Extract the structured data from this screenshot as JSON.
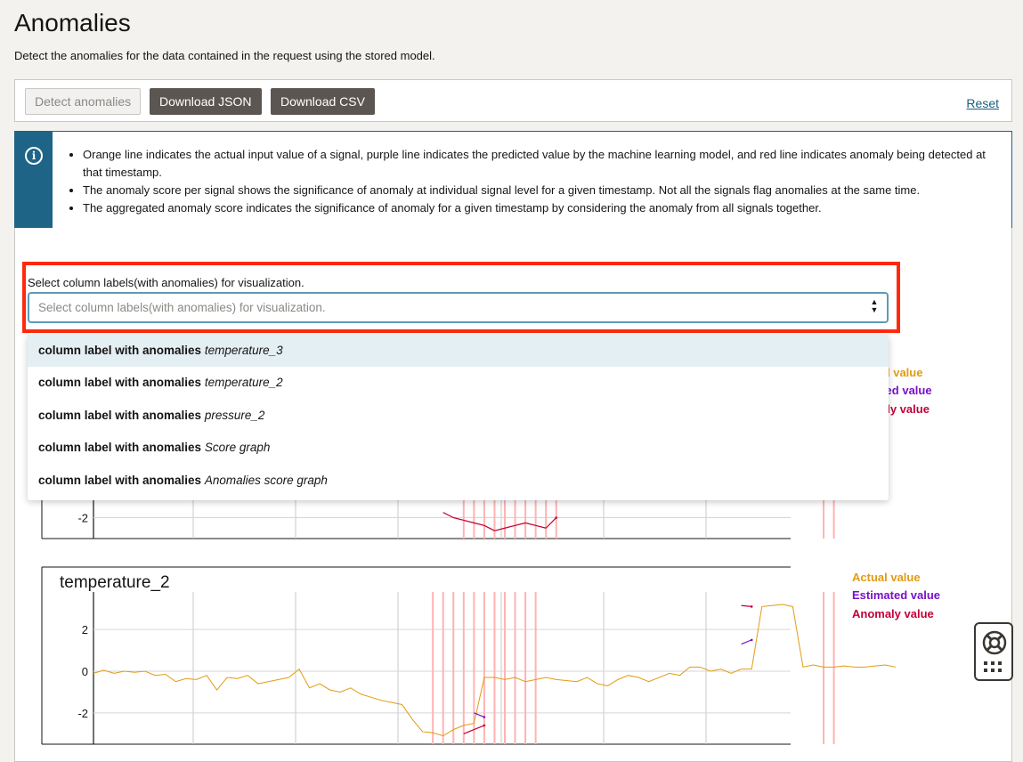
{
  "page": {
    "title": "Anomalies",
    "subtitle": "Detect the anomalies for the data contained in the request using the stored model."
  },
  "toolbar": {
    "detect_label": "Detect anomalies",
    "download_json_label": "Download JSON",
    "download_csv_label": "Download CSV",
    "reset_label": "Reset"
  },
  "info": {
    "icon": "info-icon",
    "items": [
      "Orange line indicates the actual input value of a signal, purple line indicates the predicted value by the machine learning model, and red line indicates anomaly being detected at that timestamp.",
      "The anomaly score per signal shows the significance of anomaly at individual signal level for a given timestamp. Not all the signals flag anomalies at the same time.",
      "The aggregated anomaly score indicates the significance of anomaly for a given timestamp by considering the anomaly from all signals together."
    ]
  },
  "select": {
    "label": "Select column labels(with anomalies) for visualization.",
    "placeholder": "Select column labels(with anomalies) for visualization.",
    "options": [
      {
        "prefix": "column label with anomalies",
        "name": "temperature_3"
      },
      {
        "prefix": "column label with anomalies",
        "name": "temperature_2"
      },
      {
        "prefix": "column label with anomalies",
        "name": "pressure_2"
      },
      {
        "prefix": "column label with anomalies",
        "name": "Score graph"
      },
      {
        "prefix": "column label with anomalies",
        "name": "Anomalies score graph"
      }
    ]
  },
  "legend": {
    "actual": "Actual value",
    "estimated": "Estimated value",
    "anomaly": "Anomaly value",
    "actual_partial": "l value",
    "estimated_partial": "ated value",
    "anomaly_partial": "aly value",
    "colors": {
      "actual": "#e39a12",
      "estimated": "#7a0fc9",
      "anomaly": "#c20037",
      "anomaly_marker": "#ffb3b3"
    }
  },
  "chart_data": [
    {
      "type": "line",
      "title": "temperature_3",
      "visible_ticks": [
        -2
      ],
      "ylim": [
        -2.8,
        3.5
      ],
      "grid": true,
      "series": [
        {
          "name": "Actual value",
          "x": [
            34,
            35,
            36,
            37,
            38,
            39,
            40,
            41,
            42,
            43,
            44,
            45
          ],
          "values": [
            -1.8,
            -2.0,
            -2.1,
            -2.2,
            -2.3,
            -2.5,
            -2.4,
            -2.3,
            -2.2,
            -2.3,
            -2.4,
            -2.0
          ]
        },
        {
          "name": "Anomaly value",
          "x": [
            34,
            35,
            36,
            37,
            38,
            39,
            40,
            41,
            42,
            43,
            44,
            45
          ],
          "values": [
            -1.8,
            -2.0,
            -2.1,
            -2.2,
            -2.3,
            -2.5,
            -2.4,
            -2.3,
            -2.2,
            -2.3,
            -2.4,
            -2.0
          ]
        }
      ],
      "anomaly_x": [
        36,
        37,
        38,
        39,
        40,
        41,
        42,
        43,
        44,
        45,
        71,
        72
      ]
    },
    {
      "type": "line",
      "title": "temperature_2",
      "ylim": [
        -3.5,
        3.8
      ],
      "yticks": [
        -2,
        0,
        2
      ],
      "grid": true,
      "x_range": [
        0,
        78
      ],
      "series": [
        {
          "name": "Actual value",
          "x": [
            0,
            1,
            2,
            3,
            4,
            5,
            6,
            7,
            8,
            9,
            10,
            11,
            12,
            13,
            14,
            15,
            16,
            17,
            18,
            19,
            20,
            21,
            22,
            23,
            24,
            25,
            26,
            27,
            28,
            29,
            30,
            31,
            32,
            33,
            34,
            35,
            36,
            37,
            38,
            39,
            40,
            41,
            42,
            43,
            44,
            45,
            46,
            47,
            48,
            49,
            50,
            51,
            52,
            53,
            54,
            55,
            56,
            57,
            58,
            59,
            60,
            61,
            62,
            63,
            64,
            65,
            66,
            67,
            68,
            69,
            70,
            71,
            72,
            73,
            74,
            75,
            76,
            77,
            78
          ],
          "values": [
            -0.1,
            0.05,
            -0.1,
            0.0,
            -0.05,
            0.0,
            -0.2,
            -0.15,
            -0.5,
            -0.35,
            -0.4,
            -0.2,
            -0.9,
            -0.3,
            -0.35,
            -0.2,
            -0.6,
            -0.5,
            -0.4,
            -0.3,
            0.1,
            -0.8,
            -0.6,
            -0.9,
            -1.0,
            -0.8,
            -1.1,
            -1.25,
            -1.4,
            -1.5,
            -1.6,
            -2.3,
            -2.9,
            -2.95,
            -3.1,
            -2.8,
            -2.6,
            -2.5,
            -0.3,
            -0.3,
            -0.4,
            -0.3,
            -0.5,
            -0.4,
            -0.3,
            -0.4,
            -0.45,
            -0.5,
            -0.3,
            -0.6,
            -0.7,
            -0.4,
            -0.2,
            -0.3,
            -0.5,
            -0.3,
            -0.1,
            -0.2,
            0.2,
            0.2,
            0.0,
            0.1,
            -0.1,
            0.1,
            0.1,
            3.1,
            3.15,
            3.2,
            3.1,
            0.2,
            0.3,
            0.2,
            0.2,
            0.25,
            0.2,
            0.2,
            0.25,
            0.3,
            0.2
          ]
        },
        {
          "name": "Estimated value",
          "x": [
            37,
            38,
            63,
            64
          ],
          "values": [
            -2.0,
            -2.2,
            1.3,
            1.5
          ]
        },
        {
          "name": "Anomaly value",
          "x": [
            36,
            37,
            38,
            63,
            64
          ],
          "values": [
            -3.0,
            -2.8,
            -2.6,
            3.15,
            3.1
          ]
        }
      ],
      "anomaly_x": [
        33,
        34,
        35,
        36,
        37,
        38,
        39,
        40,
        41,
        42,
        43,
        71,
        72
      ]
    }
  ]
}
